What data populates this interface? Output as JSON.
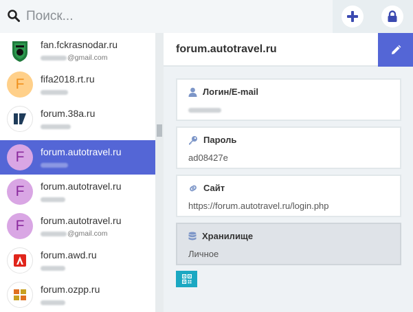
{
  "colors": {
    "accent": "#5466d6",
    "qr": "#1ba8c2",
    "icon": "#7d96c8"
  },
  "search": {
    "placeholder": "Поиск..."
  },
  "list": {
    "items": [
      {
        "title": "fan.fckrasnodar.ru",
        "sub_suffix": "@gmail.com",
        "avatar_letter": "",
        "avatar_icon": "fc-krasnodar-logo",
        "avatar_bg": "#ffffff",
        "avatar_fg": "#1f7a3c"
      },
      {
        "title": "fifa2018.rt.ru",
        "sub_suffix": "",
        "avatar_letter": "F",
        "avatar_icon": "",
        "avatar_bg": "#ffd08a",
        "avatar_fg": "#f0901c"
      },
      {
        "title": "forum.38a.ru",
        "sub_suffix": "",
        "avatar_letter": "",
        "avatar_icon": "38a-logo",
        "avatar_bg": "#ffffff",
        "avatar_fg": "#1f3c5a"
      },
      {
        "title": "forum.autotravel.ru",
        "sub_suffix": "",
        "avatar_letter": "F",
        "avatar_icon": "",
        "avatar_bg": "#d9a6e4",
        "avatar_fg": "#8a2a9e"
      },
      {
        "title": "forum.autotravel.ru",
        "sub_suffix": "",
        "avatar_letter": "F",
        "avatar_icon": "",
        "avatar_bg": "#d9a6e4",
        "avatar_fg": "#8a2a9e"
      },
      {
        "title": "forum.autotravel.ru",
        "sub_suffix": "@gmail.com",
        "avatar_letter": "F",
        "avatar_icon": "",
        "avatar_bg": "#d9a6e4",
        "avatar_fg": "#8a2a9e"
      },
      {
        "title": "forum.awd.ru",
        "sub_suffix": "",
        "avatar_letter": "",
        "avatar_icon": "awd-logo",
        "avatar_bg": "#ffffff",
        "avatar_fg": "#e0251b"
      },
      {
        "title": "forum.ozpp.ru",
        "sub_suffix": "",
        "avatar_letter": "",
        "avatar_icon": "ozpp-logo",
        "avatar_bg": "#ffffff",
        "avatar_fg": "#e07020"
      }
    ],
    "selected_index": 3
  },
  "detail": {
    "title": "forum.autotravel.ru",
    "login": {
      "label": "Логин/E-mail",
      "icon": "user-icon"
    },
    "password": {
      "label": "Пароль",
      "value": "ad08427e",
      "icon": "key-icon"
    },
    "site": {
      "label": "Сайт",
      "value": "https://forum.autotravel.ru/login.php",
      "icon": "link-icon"
    },
    "storage": {
      "label": "Хранилище",
      "value": "Личное",
      "icon": "database-icon"
    }
  }
}
